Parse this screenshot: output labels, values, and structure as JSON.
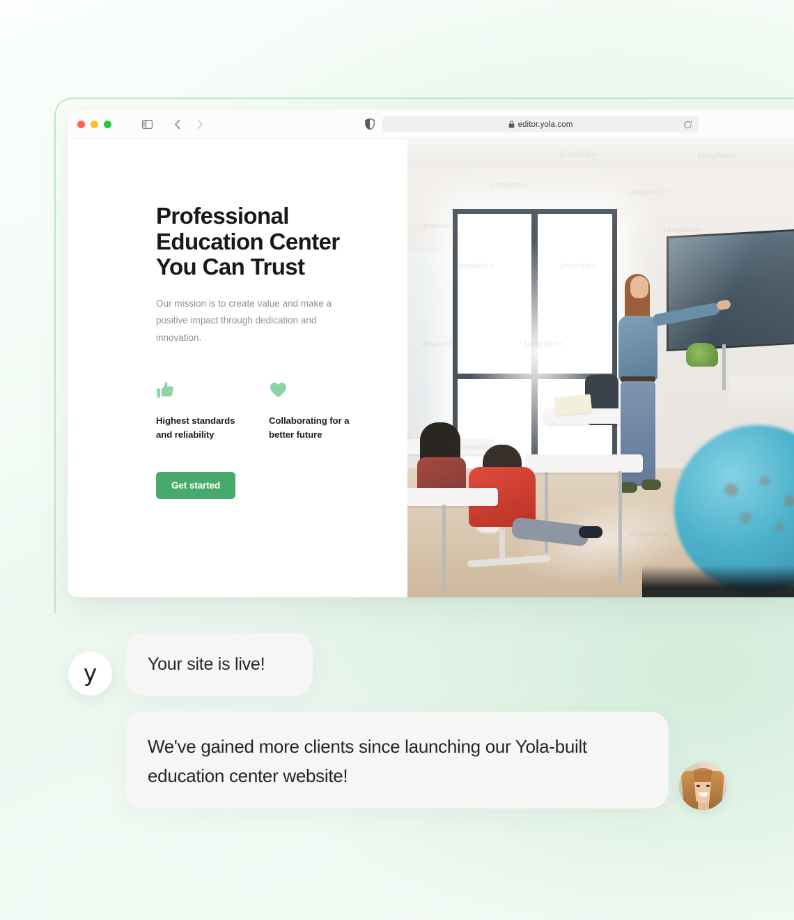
{
  "browser": {
    "traffic_lights": [
      "close",
      "minimize",
      "maximize"
    ],
    "sidebar_icon": "sidebar-toggle-icon",
    "back_icon": "chevron-left-icon",
    "forward_icon": "chevron-right-icon",
    "shield_icon": "privacy-shield-icon",
    "lock_icon": "lock-icon",
    "url": "editor.yola.com",
    "reload_icon": "reload-icon"
  },
  "site": {
    "headline": "Professional Education Center You Can Trust",
    "subtext": "Our mission is to create value and make a positive impact through dedication and innovation.",
    "features": [
      {
        "icon": "thumbs-up-icon",
        "label": "Highest standards and reliability"
      },
      {
        "icon": "heart-icon",
        "label": "Collaborating for a better future"
      }
    ],
    "cta_label": "Get started",
    "photo_alt": "classroom-photo",
    "photo_watermarks": [
      "Unsplash+",
      "Unsplash+",
      "Unsplash+",
      "Unsplash+",
      "Unsplash+",
      "Unsplash+",
      "Unsplash+",
      "Unsplash+",
      "Unsplash+",
      "Unsplash+",
      "Unsplash+",
      "Unsplash+"
    ]
  },
  "chat": {
    "brand_initial": "y",
    "message_1": "Your site is live!",
    "message_2": "We've gained more clients since launching our Yola-built education center website!",
    "client_avatar": "client-photo-avatar"
  },
  "colors": {
    "brand_green": "#47a96c",
    "accent_light_green": "#8ed3a6",
    "frame_green": "#bfe6c9",
    "background_mint": "#e2f3e7",
    "bubble_grey": "#f5f6f5",
    "text_dark": "#16191c",
    "text_muted": "#8b9096"
  }
}
